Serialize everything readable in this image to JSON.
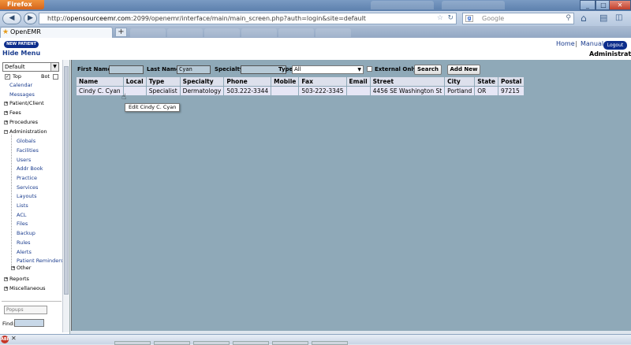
{
  "browser": {
    "app_button": "Firefox",
    "url_prefix": "http://",
    "url_host": "opensourceemr.com",
    "url_rest": ":2099/openemr/interface/main/main_screen.php?auth=login&site=default",
    "search_engine_placeholder": "Google",
    "tab_title": "OpenEMR",
    "new_tab": "+"
  },
  "header": {
    "new_patient": "NEW PATIENT",
    "hide_menu": "Hide Menu",
    "home": "Home",
    "separator": "|",
    "manual": "Manual",
    "logout": "Logout",
    "user_role": "Administrator"
  },
  "sidebar": {
    "layout_select": "Default",
    "top_label": "Top",
    "bot_label": "Bot",
    "top_checked": true,
    "bot_checked": false,
    "items": [
      {
        "label": "Calendar",
        "type": "link"
      },
      {
        "label": "Messages",
        "type": "link"
      },
      {
        "label": "Patient/Client",
        "type": "folder"
      },
      {
        "label": "Fees",
        "type": "folder"
      },
      {
        "label": "Procedures",
        "type": "folder"
      },
      {
        "label": "Administration",
        "type": "folder-open"
      },
      {
        "label": "Reports",
        "type": "folder"
      },
      {
        "label": "Miscellaneous",
        "type": "folder"
      }
    ],
    "admin_children": [
      "Globals",
      "Facilities",
      "Users",
      "Addr Book",
      "Practice",
      "Services",
      "Layouts",
      "Lists",
      "ACL",
      "Files",
      "Backup",
      "Rules",
      "Alerts",
      "Patient Reminders",
      "Other"
    ],
    "popups_select": "Popups",
    "find_label": "Find:"
  },
  "search_form": {
    "first_name_label": "First Name:",
    "first_name_value": "",
    "last_name_label": "Last Name:",
    "last_name_value": "Cyan",
    "specialty_label": "Specialty:",
    "specialty_value": "",
    "type_label": "Type:",
    "type_value": "All",
    "external_only_label": "External Only",
    "search_button": "Search",
    "add_new_button": "Add New"
  },
  "results": {
    "columns": [
      "Name",
      "Local",
      "Type",
      "Specialty",
      "Phone",
      "Mobile",
      "Fax",
      "Email",
      "Street",
      "City",
      "State",
      "Postal"
    ],
    "rows": [
      [
        "Cindy C. Cyan",
        "",
        "Specialist",
        "Dermatology",
        "503.222-3344",
        "",
        "503-222-3345",
        "",
        "4456 SE Washington St",
        "Portland",
        "OR",
        "97215"
      ]
    ]
  },
  "tooltip": "Edit Cindy C. Cyan"
}
